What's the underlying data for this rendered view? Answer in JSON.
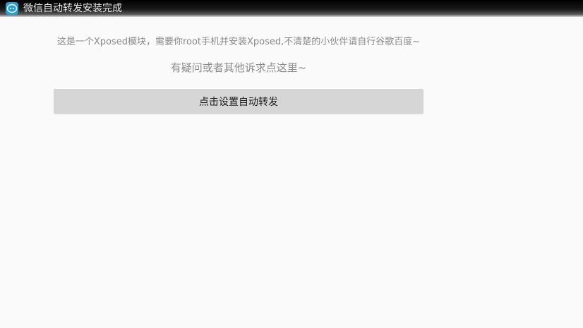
{
  "titlebar": {
    "title": "微信自动转发安装完成",
    "icon": "app-logo-icon"
  },
  "content": {
    "description": "这是一个Xposed模块，需要你root手机并安装Xposed,不清楚的小伙伴请自行谷歌百度~",
    "help_link": "有疑问或者其他诉求点这里~",
    "button_label": "点击设置自动转发"
  },
  "colors": {
    "background": "#fafafa",
    "button": "#d6d6d6",
    "secondary_text": "#8a8a8a",
    "icon_blue": "#2a9fd6"
  }
}
